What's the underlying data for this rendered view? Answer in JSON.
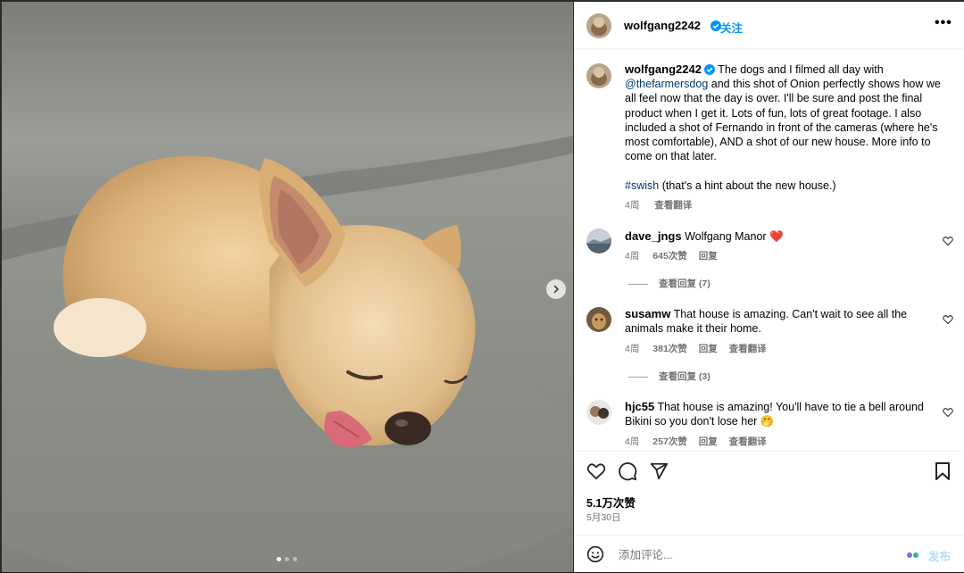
{
  "header": {
    "username": "wolfgang2242",
    "follow_label": "关注",
    "more_label": "•••"
  },
  "caption": {
    "username": "wolfgang2242",
    "text_before_mention": "The dogs and I filmed all day with",
    "mention": "@thefarmersdog",
    "text_after_mention": "and this shot of Onion perfectly shows how we all feel now that the day is over. I'll be sure and post the final product when I get it. Lots of fun, lots of great footage. I also included a shot of Fernando in front of the cameras (where he's most comfortable), AND a shot of our new house. More info to come on that later.",
    "hashtag": "#swish",
    "hashtag_note": "(that's a hint about the new house.)",
    "time": "4周",
    "translate": "查看翻译"
  },
  "comments": [
    {
      "username": "dave_jngs",
      "text": "Wolfgang Manor",
      "emoji": "❤️",
      "time": "4周",
      "likes": "645次赞",
      "reply": "回复",
      "view_replies": "查看回复 (7)"
    },
    {
      "username": "susamw",
      "text": "That house is amazing. Can't wait to see all the animals make it their home.",
      "time": "4周",
      "likes": "381次赞",
      "reply": "回复",
      "translate": "查看翻译",
      "view_replies": "查看回复 (3)"
    },
    {
      "username": "hjc55",
      "text": "That house is amazing! You'll have to tie a bell around Bikini so you don't lose her",
      "emoji": "🤭",
      "time": "4周",
      "likes": "257次赞",
      "reply": "回复",
      "translate": "查看翻译"
    }
  ],
  "post": {
    "likes": "5.1万次赞",
    "date": "5月30日"
  },
  "composer": {
    "placeholder": "添加评论...",
    "post_label": "发布"
  },
  "carousel": {
    "total_slides": 3,
    "active_slide": 1
  },
  "colors": {
    "link": "#0095f6",
    "mention": "#00376b",
    "heart": "#ed4956",
    "meta": "#737373"
  }
}
